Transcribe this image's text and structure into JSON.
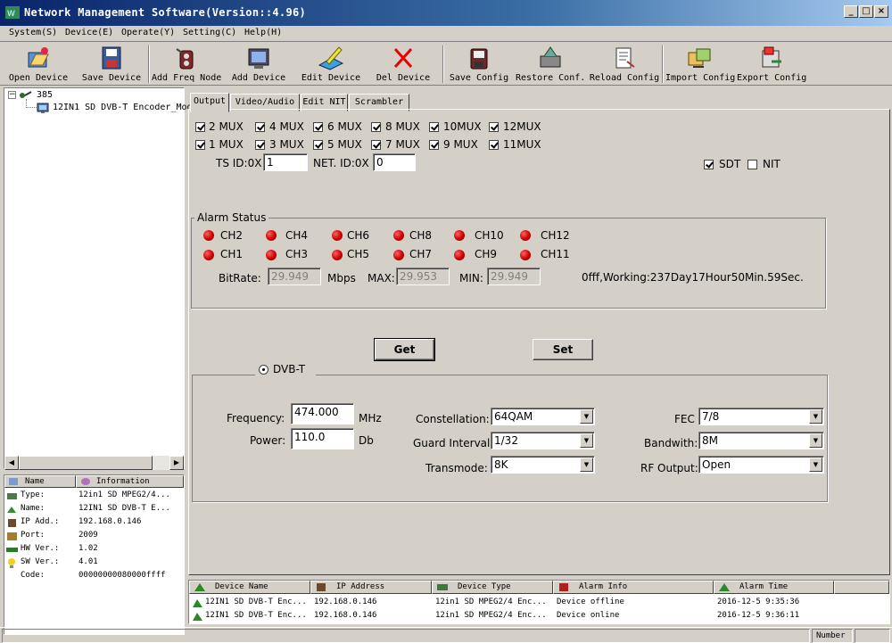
{
  "window": {
    "title": "Network Management Software(Version::4.96)",
    "controls": {
      "minimize": "_",
      "maximize": "□",
      "close": "×"
    }
  },
  "menu": [
    "System(S)",
    "Device(E)",
    "Operate(Y)",
    "Setting(C)",
    "Help(H)"
  ],
  "toolbar": [
    {
      "label": "Open Device",
      "icon": "open-device-icon"
    },
    {
      "label": "Save Device",
      "icon": "save-device-icon"
    },
    {
      "label": "Add Freq Node",
      "icon": "add-freq-node-icon"
    },
    {
      "label": "Add Device",
      "icon": "add-device-icon"
    },
    {
      "label": "Edit Device",
      "icon": "edit-device-icon"
    },
    {
      "label": "Del Device",
      "icon": "delete-device-icon"
    },
    {
      "label": "Save Config",
      "icon": "save-config-icon"
    },
    {
      "label": "Restore Conf.",
      "icon": "restore-config-icon"
    },
    {
      "label": "Reload Config",
      "icon": "reload-config-icon"
    },
    {
      "label": "Import Config",
      "icon": "import-config-icon"
    },
    {
      "label": "Export Config",
      "icon": "export-config-icon"
    }
  ],
  "tree": {
    "root": "385",
    "child": "12IN1 SD DVB-T Encoder_Modu"
  },
  "info": {
    "headers": [
      "Name",
      "Information"
    ],
    "rows": [
      {
        "key": "Type:",
        "value": "12in1 SD MPEG2/4..."
      },
      {
        "key": "Name:",
        "value": "12IN1 SD DVB-T E..."
      },
      {
        "key": "IP Add.:",
        "value": "192.168.0.146"
      },
      {
        "key": "Port:",
        "value": "2009"
      },
      {
        "key": "HW Ver.:",
        "value": "1.02"
      },
      {
        "key": "SW Ver.:",
        "value": "4.01"
      },
      {
        "key": "Code:",
        "value": "00000000080000ffff"
      }
    ]
  },
  "tabs": [
    "Output",
    "Video/Audio",
    "Edit NIT",
    "Scrambler"
  ],
  "mux_row1": [
    "2 MUX",
    "4 MUX",
    "6 MUX",
    "8 MUX",
    "10MUX",
    "12MUX"
  ],
  "mux_row2": [
    "1 MUX",
    "3 MUX",
    "5 MUX",
    "7 MUX",
    "9 MUX",
    "11MUX"
  ],
  "ids": {
    "ts_label": "TS ID:0X",
    "ts_value": "1",
    "net_label": "NET. ID:0X",
    "net_value": "0",
    "sdt": "SDT",
    "nit": "NIT"
  },
  "alarm": {
    "title": "Alarm Status",
    "row1": [
      "CH2",
      "CH4",
      "CH6",
      "CH8",
      "CH10",
      "CH12"
    ],
    "row2": [
      "CH1",
      "CH3",
      "CH5",
      "CH7",
      "CH9",
      "CH11"
    ],
    "bitrate_label": "BitRate:",
    "bitrate": "29.949",
    "mbps": "Mbps",
    "max_label": "MAX:",
    "max": "29.953",
    "min_label": "MIN:",
    "min": "29.949",
    "status": "0fff,Working:237Day17Hour50Min.59Sec.",
    "led_color": "#cc0000"
  },
  "buttons": {
    "get": "Get",
    "set": "Set"
  },
  "dvbt": {
    "title": "DVB-T",
    "frequency_label": "Frequency:",
    "frequency": "474.000",
    "frequency_unit": "MHz",
    "power_label": "Power:",
    "power": "110.0",
    "power_unit": "Db",
    "constellation_label": "Constellation:",
    "constellation": "64QAM",
    "guard_label": "Guard Interval",
    "guard": "1/32",
    "transmode_label": "Transmode:",
    "transmode": "8K",
    "fec_label": "FEC",
    "fec": "7/8",
    "bandwidth_label": "Bandwith:",
    "bandwidth": "8M",
    "rf_label": "RF Output:",
    "rf": "Open"
  },
  "devices": {
    "headers": [
      "Device Name",
      "IP Address",
      "Device Type",
      "Alarm Info",
      "Alarm Time"
    ],
    "rows": [
      [
        "12IN1 SD DVB-T Enc...",
        "192.168.0.146",
        "12in1 SD MPEG2/4 Enc...",
        "Device offline",
        "2016-12-5 9:35:36"
      ],
      [
        "12IN1 SD DVB-T Enc...",
        "192.168.0.146",
        "12in1 SD MPEG2/4 Enc...",
        "Device online",
        "2016-12-5 9:36:11"
      ]
    ]
  },
  "status": {
    "number": "Number"
  }
}
